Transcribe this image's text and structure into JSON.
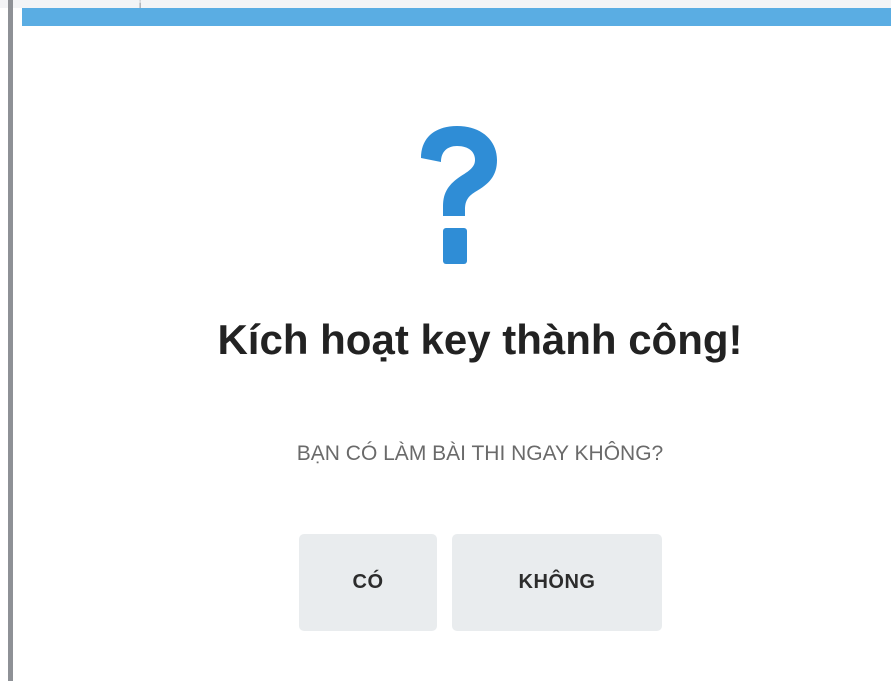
{
  "dialog": {
    "icon": "question-mark-icon",
    "title": "Kích hoạt key thành công!",
    "message": "BẠN CÓ LÀM BÀI THI NGAY KHÔNG?",
    "buttons": {
      "yes_label": "CÓ",
      "no_label": "KHÔNG"
    }
  },
  "colors": {
    "accent_bar": "#5aade3",
    "icon": "#2f8dd6",
    "title": "#222222",
    "message": "#6a6a6a",
    "button_bg": "#e9ecee"
  }
}
